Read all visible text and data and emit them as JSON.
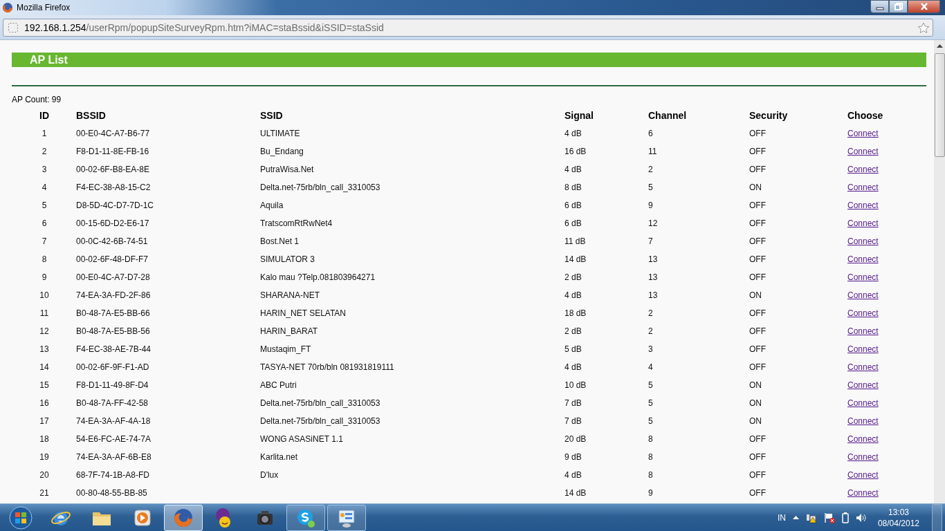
{
  "window": {
    "title": "Mozilla Firefox"
  },
  "address_bar": {
    "host": "192.168.1.254",
    "path": "/userRpm/popupSiteSurveyRpm.htm?iMAC=staBssid&iSSID=staSsid"
  },
  "page": {
    "heading": "AP List",
    "ap_count": "AP Count: 99"
  },
  "table": {
    "columns": [
      "ID",
      "BSSID",
      "SSID",
      "Signal",
      "Channel",
      "Security",
      "Choose"
    ],
    "rows": [
      {
        "id": "1",
        "bssid": "00-E0-4C-A7-B6-77",
        "ssid": "ULTIMATE",
        "signal": "4 dB",
        "channel": "6",
        "security": "OFF",
        "choose": "Connect"
      },
      {
        "id": "2",
        "bssid": "F8-D1-11-8E-FB-16",
        "ssid": "Bu_Endang",
        "signal": "16 dB",
        "channel": "11",
        "security": "OFF",
        "choose": "Connect"
      },
      {
        "id": "3",
        "bssid": "00-02-6F-B8-EA-8E",
        "ssid": "PutraWisa.Net",
        "signal": "4 dB",
        "channel": "2",
        "security": "OFF",
        "choose": "Connect"
      },
      {
        "id": "4",
        "bssid": "F4-EC-38-A8-15-C2",
        "ssid": "Delta.net-75rb/bln_call_3310053",
        "signal": "8 dB",
        "channel": "5",
        "security": "ON",
        "choose": "Connect"
      },
      {
        "id": "5",
        "bssid": "D8-5D-4C-D7-7D-1C",
        "ssid": "Aquila",
        "signal": "6 dB",
        "channel": "9",
        "security": "OFF",
        "choose": "Connect"
      },
      {
        "id": "6",
        "bssid": "00-15-6D-D2-E6-17",
        "ssid": "TratscomRtRwNet4",
        "signal": "6 dB",
        "channel": "12",
        "security": "OFF",
        "choose": "Connect"
      },
      {
        "id": "7",
        "bssid": "00-0C-42-6B-74-51",
        "ssid": "Bost.Net 1",
        "signal": "11 dB",
        "channel": "7",
        "security": "OFF",
        "choose": "Connect"
      },
      {
        "id": "8",
        "bssid": "00-02-6F-48-DF-F7",
        "ssid": "SIMULATOR 3",
        "signal": "14 dB",
        "channel": "13",
        "security": "OFF",
        "choose": "Connect"
      },
      {
        "id": "9",
        "bssid": "00-E0-4C-A7-D7-28",
        "ssid": "Kalo mau ?Telp.081803964271",
        "signal": "2 dB",
        "channel": "13",
        "security": "OFF",
        "choose": "Connect"
      },
      {
        "id": "10",
        "bssid": "74-EA-3A-FD-2F-86",
        "ssid": "SHARANA-NET",
        "signal": "4 dB",
        "channel": "13",
        "security": "ON",
        "choose": "Connect"
      },
      {
        "id": "11",
        "bssid": "B0-48-7A-E5-BB-66",
        "ssid": "HARIN_NET SELATAN",
        "signal": "18 dB",
        "channel": "2",
        "security": "OFF",
        "choose": "Connect"
      },
      {
        "id": "12",
        "bssid": "B0-48-7A-E5-BB-56",
        "ssid": "HARIN_BARAT",
        "signal": "2 dB",
        "channel": "2",
        "security": "OFF",
        "choose": "Connect"
      },
      {
        "id": "13",
        "bssid": "F4-EC-38-AE-7B-44",
        "ssid": "Mustaqim_FT",
        "signal": "5 dB",
        "channel": "3",
        "security": "OFF",
        "choose": "Connect"
      },
      {
        "id": "14",
        "bssid": "00-02-6F-9F-F1-AD",
        "ssid": "TASYA-NET 70rb/bln 081931819111",
        "signal": "4 dB",
        "channel": "4",
        "security": "OFF",
        "choose": "Connect"
      },
      {
        "id": "15",
        "bssid": "F8-D1-11-49-8F-D4",
        "ssid": "ABC Putri",
        "signal": "10 dB",
        "channel": "5",
        "security": "ON",
        "choose": "Connect"
      },
      {
        "id": "16",
        "bssid": "B0-48-7A-FF-42-58",
        "ssid": "Delta.net-75rb/bln_call_3310053",
        "signal": "7 dB",
        "channel": "5",
        "security": "ON",
        "choose": "Connect"
      },
      {
        "id": "17",
        "bssid": "74-EA-3A-AF-4A-18",
        "ssid": "Delta.net-75rb/bln_call_3310053",
        "signal": "7 dB",
        "channel": "5",
        "security": "ON",
        "choose": "Connect"
      },
      {
        "id": "18",
        "bssid": "54-E6-FC-AE-74-7A",
        "ssid": "WONG ASASiNET 1.1",
        "signal": "20 dB",
        "channel": "8",
        "security": "OFF",
        "choose": "Connect"
      },
      {
        "id": "19",
        "bssid": "74-EA-3A-AF-6B-E8",
        "ssid": "Karlita.net",
        "signal": "9 dB",
        "channel": "8",
        "security": "OFF",
        "choose": "Connect"
      },
      {
        "id": "20",
        "bssid": "68-7F-74-1B-A8-FD",
        "ssid": "D'lux",
        "signal": "4 dB",
        "channel": "8",
        "security": "OFF",
        "choose": "Connect"
      },
      {
        "id": "21",
        "bssid": "00-80-48-55-BB-85",
        "signal": "14 dB",
        "channel": "9",
        "security": "OFF",
        "choose": "Connect"
      }
    ]
  },
  "taskbar": {
    "apps": [
      {
        "kind": "browser-e",
        "selected": false,
        "running": false
      },
      {
        "kind": "folder",
        "selected": false,
        "running": false
      },
      {
        "kind": "media",
        "selected": false,
        "running": false
      },
      {
        "kind": "fox",
        "selected": true,
        "running": true
      },
      {
        "kind": "messenger",
        "selected": false,
        "running": false
      },
      {
        "kind": "camera",
        "selected": false,
        "running": false
      },
      {
        "kind": "chat",
        "selected": false,
        "running": true
      },
      {
        "kind": "panel",
        "selected": false,
        "running": true
      }
    ],
    "language": "IN",
    "time": "13:03",
    "date": "08/04/2012"
  }
}
